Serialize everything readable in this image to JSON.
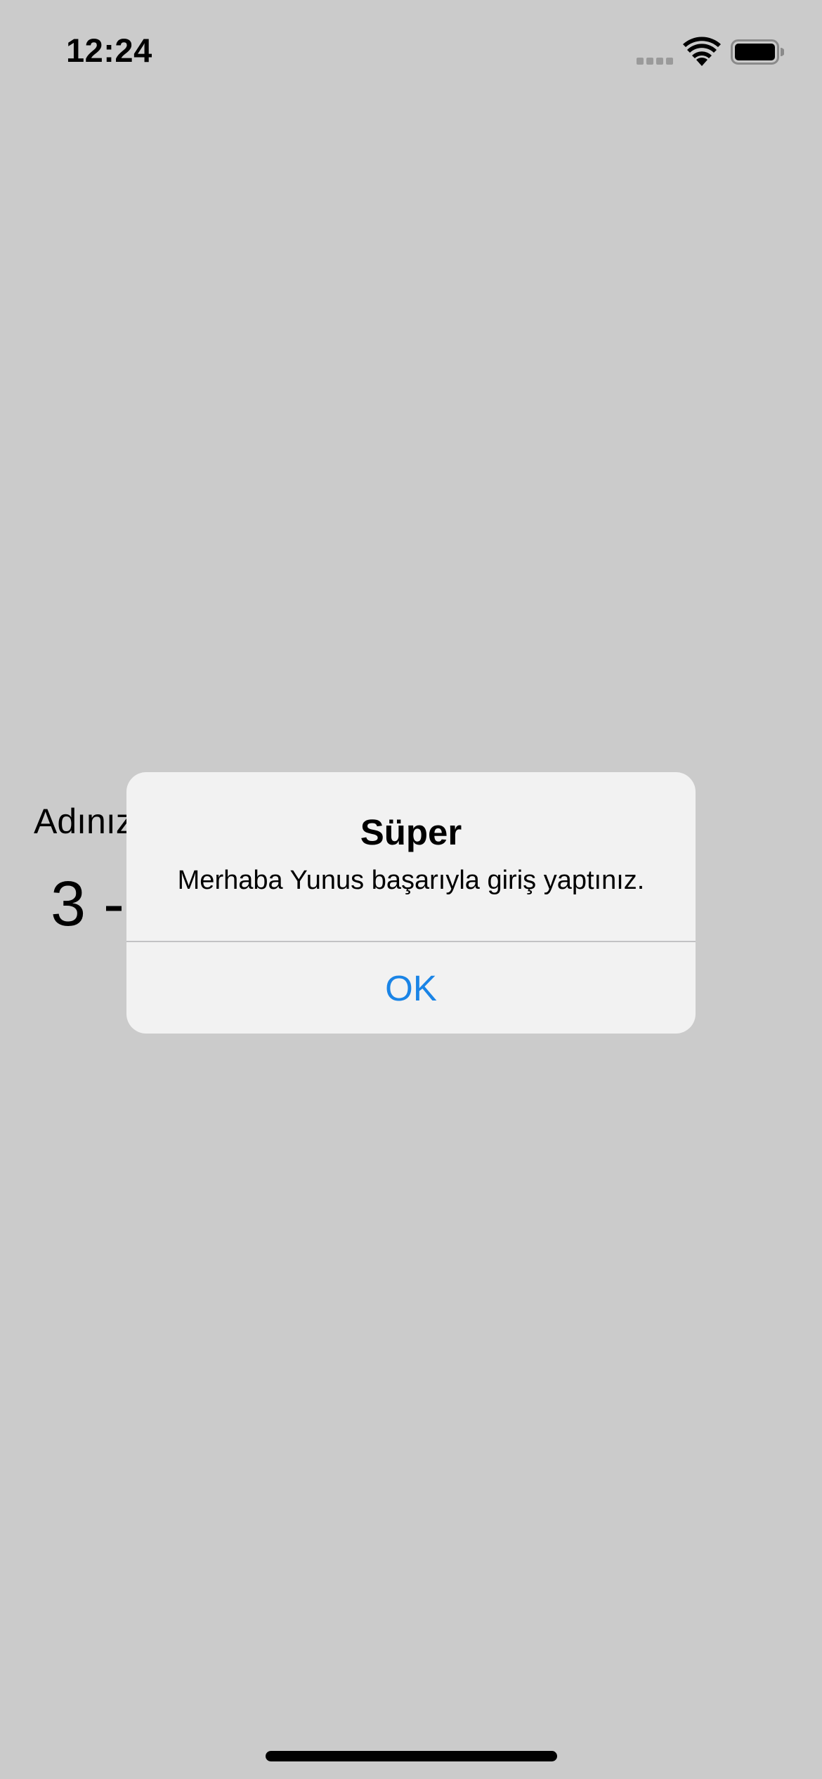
{
  "status_bar": {
    "time": "12:24",
    "icons": [
      "cellular-signal-icon",
      "wifi-icon",
      "battery-icon"
    ]
  },
  "background": {
    "name_label": "Adınız",
    "counter_text": "3 -"
  },
  "alert": {
    "title": "Süper",
    "message": "Merhaba Yunus başarıyla giriş yaptınız.",
    "ok_label": "OK",
    "button_color": "#1a84e6",
    "background_color": "#f2f2f2"
  },
  "colors": {
    "screen_background": "#cbcbcb",
    "signal_inactive": "#9a9a9a"
  }
}
